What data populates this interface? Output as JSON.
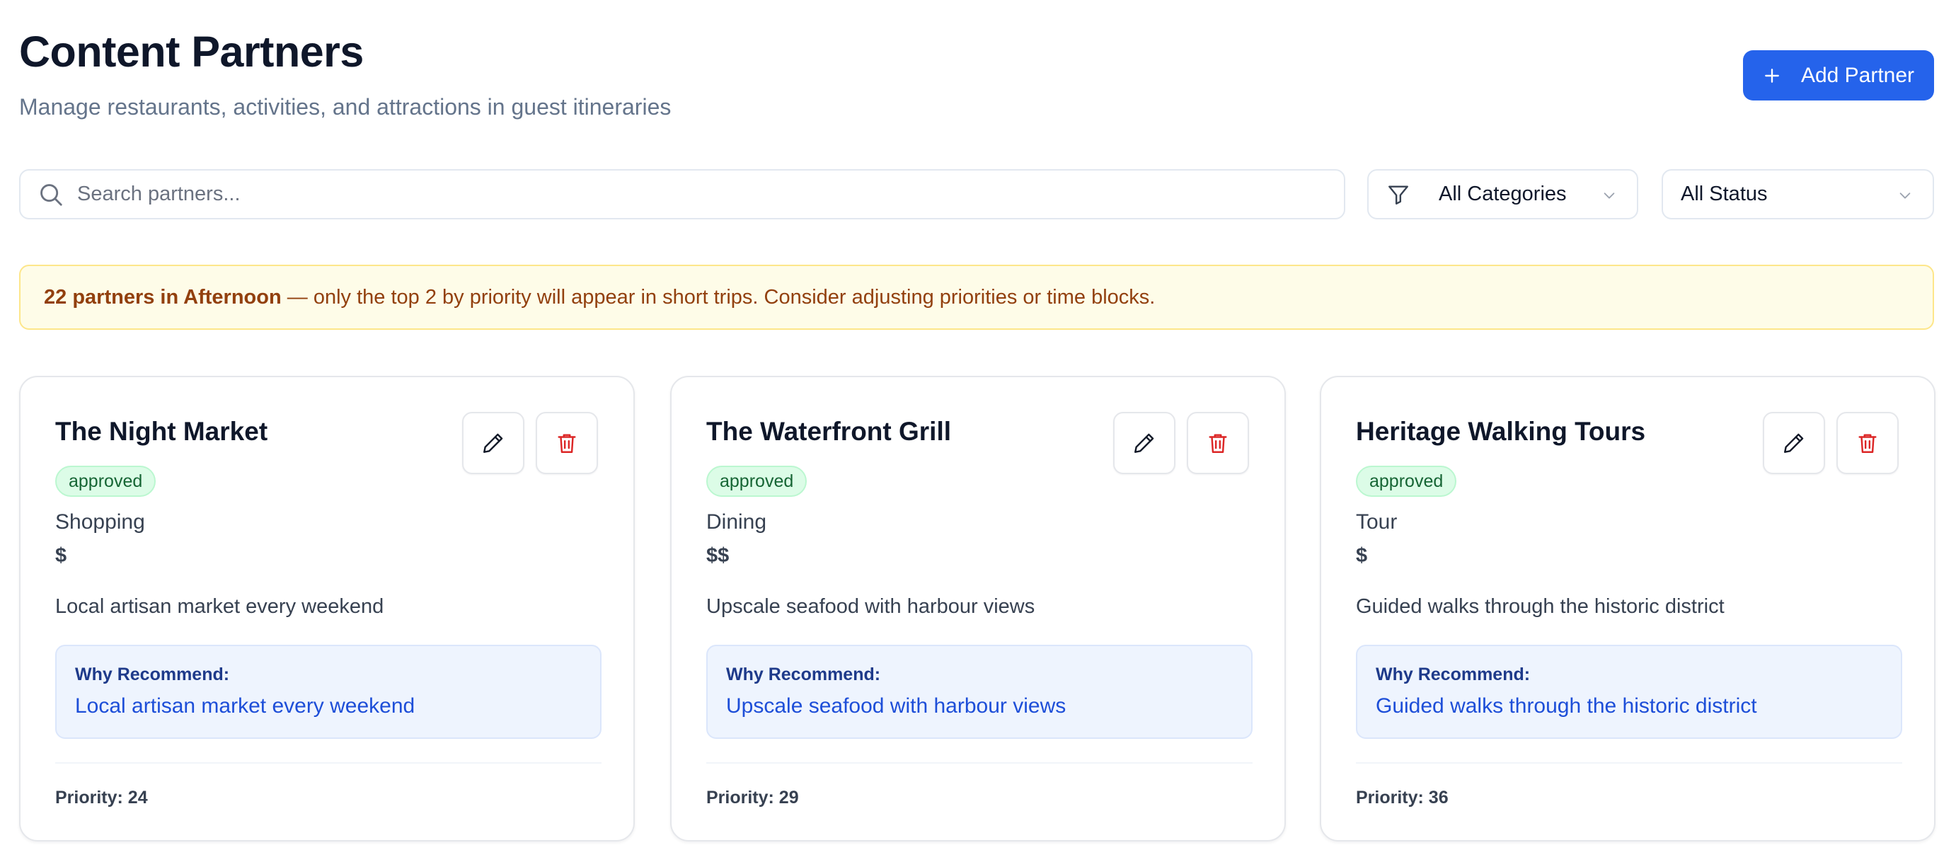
{
  "header": {
    "title": "Content Partners",
    "subtitle": "Manage restaurants, activities, and attractions in guest itineraries",
    "add_button_label": "Add Partner",
    "add_button_icon": "plus-icon"
  },
  "filters": {
    "search_placeholder": "Search partners...",
    "search_value": "",
    "category_selected": "All Categories",
    "status_selected": "All Status"
  },
  "banner": {
    "bold_text": "22 partners in Afternoon",
    "text": " — only the top 2 by priority will appear in short trips. Consider adjusting priorities or time blocks."
  },
  "cards": [
    {
      "name": "The Night Market",
      "status": "approved",
      "category": "Shopping",
      "price": "$",
      "description": "Local artisan market every weekend",
      "why_label": "Why Recommend:",
      "why_text": "Local artisan market every weekend",
      "priority": "Priority: 24"
    },
    {
      "name": "The Waterfront Grill",
      "status": "approved",
      "category": "Dining",
      "price": "$$",
      "description": "Upscale seafood with harbour views",
      "why_label": "Why Recommend:",
      "why_text": "Upscale seafood with harbour views",
      "priority": "Priority: 29"
    },
    {
      "name": "Heritage Walking Tours",
      "status": "approved",
      "category": "Tour",
      "price": "$",
      "description": "Guided walks through the historic district",
      "why_label": "Why Recommend:",
      "why_text": "Guided walks through the historic district",
      "priority": "Priority: 36"
    }
  ],
  "colors": {
    "accent": "#2563eb",
    "approved_bg": "#dcfce7",
    "approved_text": "#166534",
    "banner_bg": "#fefce8",
    "banner_text": "#92400e",
    "delete_icon": "#dc2626"
  }
}
